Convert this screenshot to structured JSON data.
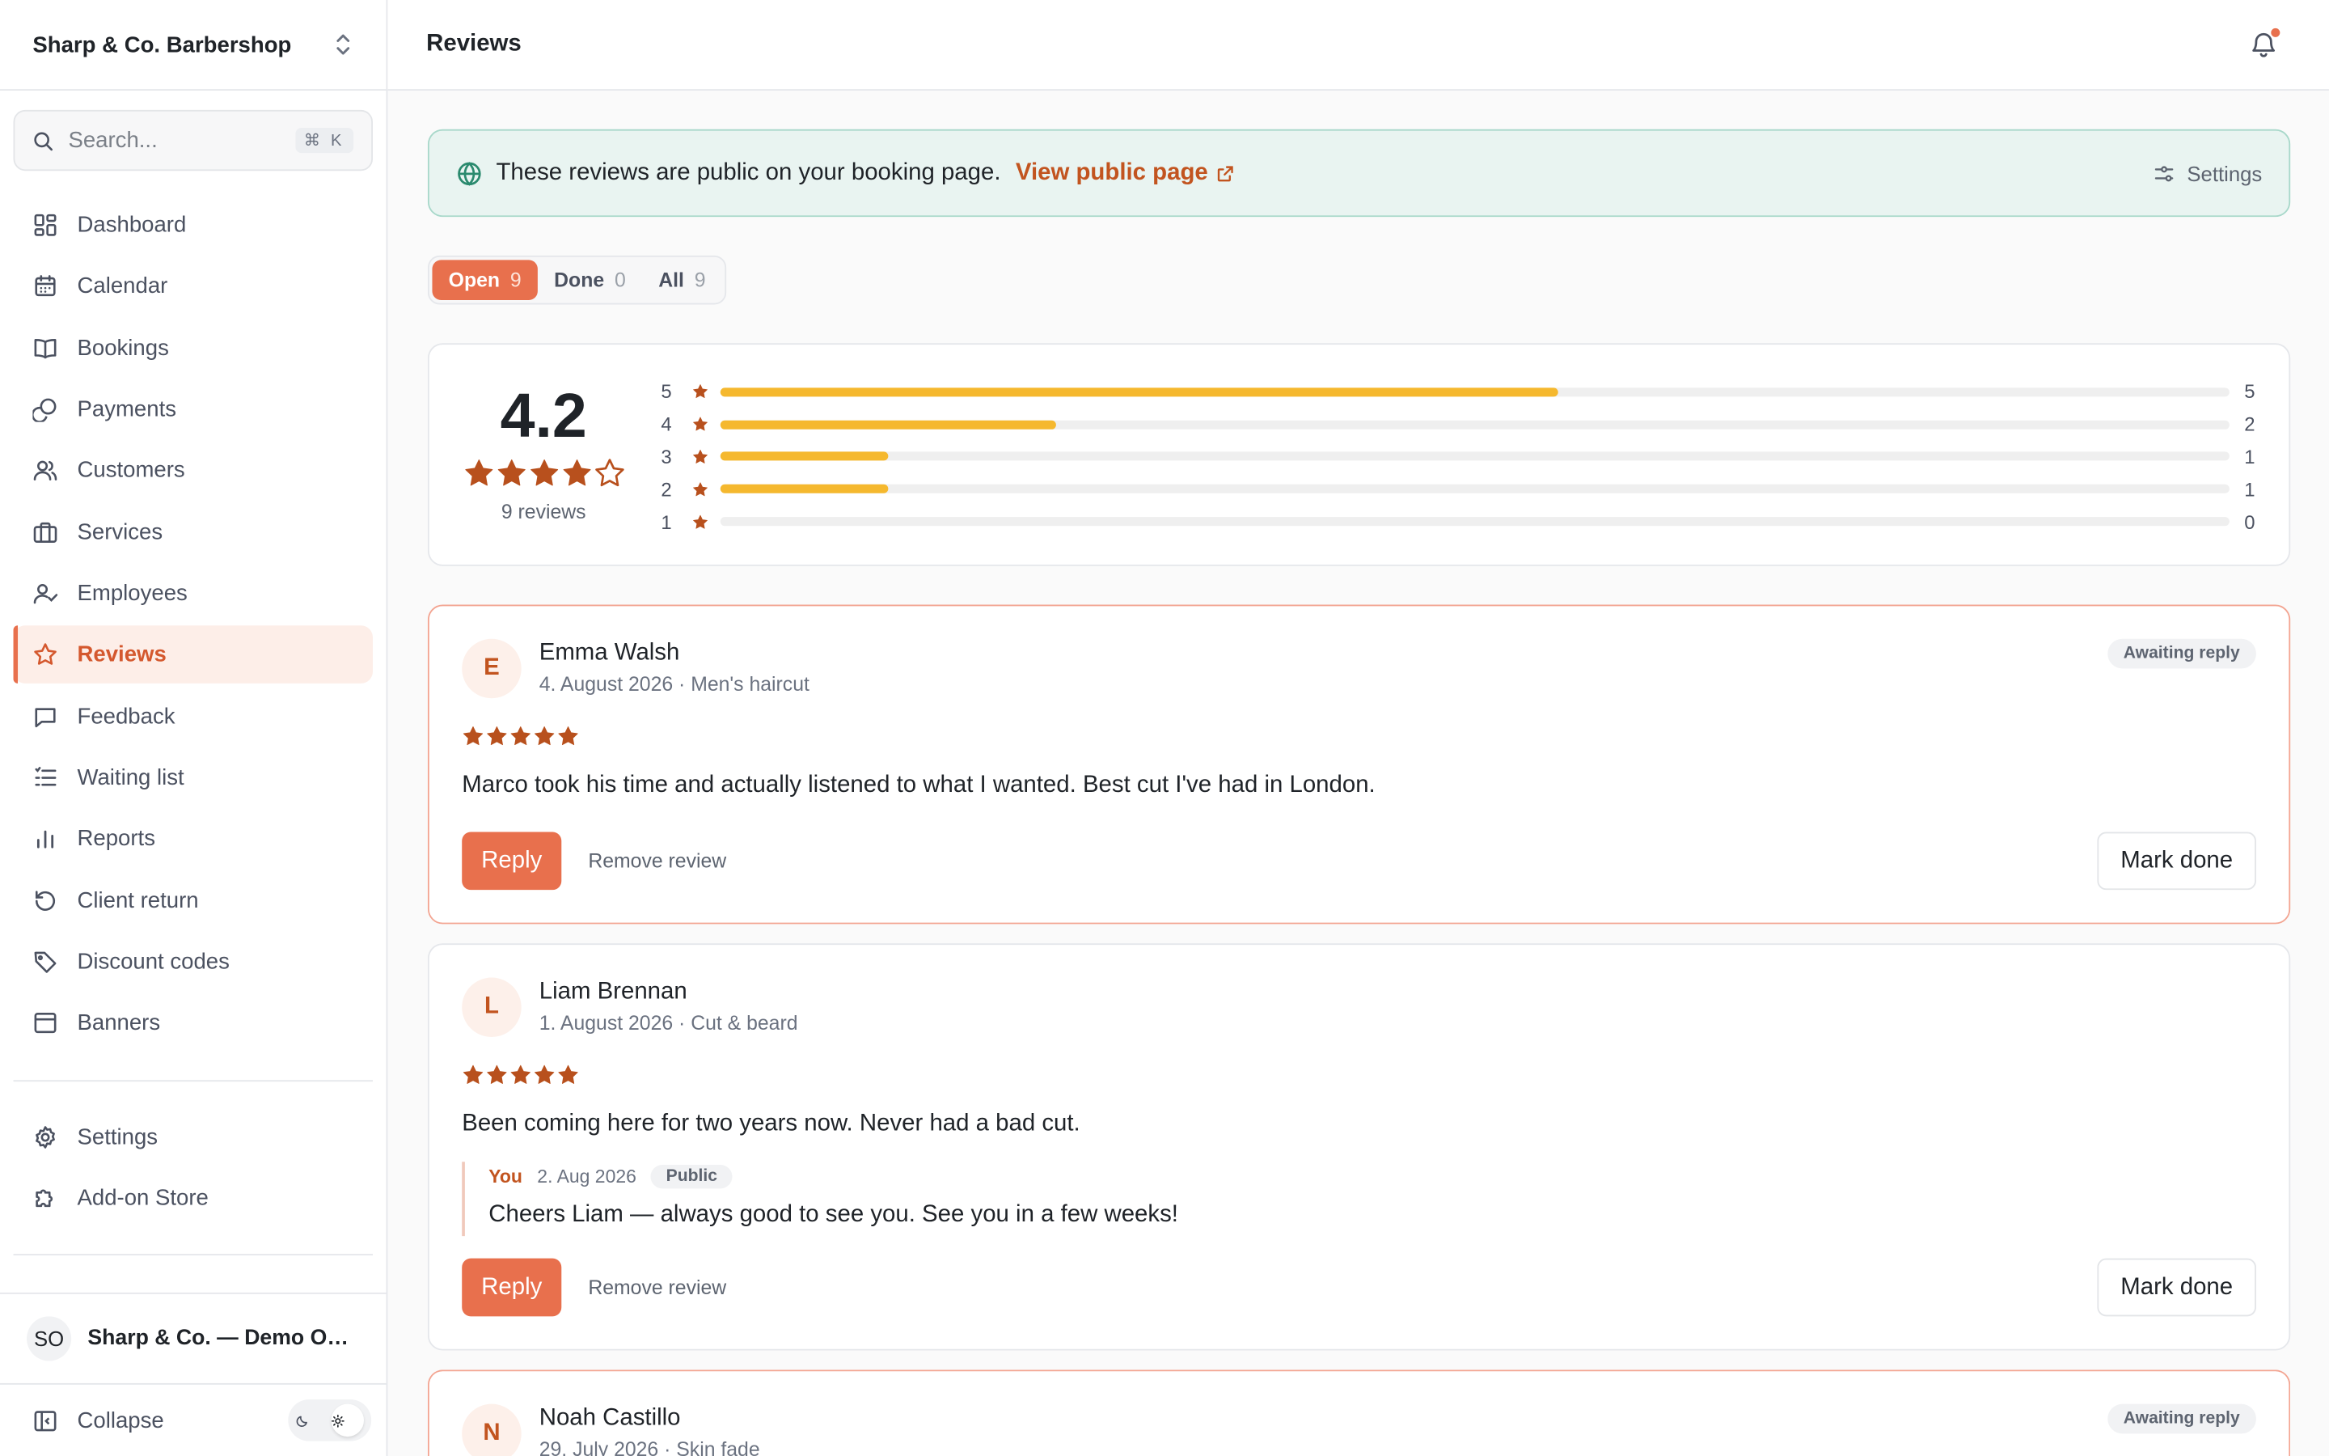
{
  "sidebar": {
    "org_name": "Sharp & Co. Barbershop",
    "search": {
      "placeholder": "Search...",
      "shortcut": "⌘ K"
    },
    "nav": [
      {
        "label": "Dashboard",
        "icon": "dashboard-icon"
      },
      {
        "label": "Calendar",
        "icon": "calendar-icon"
      },
      {
        "label": "Bookings",
        "icon": "book-icon"
      },
      {
        "label": "Payments",
        "icon": "coins-icon"
      },
      {
        "label": "Customers",
        "icon": "users-icon"
      },
      {
        "label": "Services",
        "icon": "briefcase-icon"
      },
      {
        "label": "Employees",
        "icon": "user-check-icon"
      },
      {
        "label": "Reviews",
        "icon": "star-icon",
        "active": true
      },
      {
        "label": "Feedback",
        "icon": "message-icon"
      },
      {
        "label": "Waiting list",
        "icon": "list-icon"
      },
      {
        "label": "Reports",
        "icon": "bar-chart-icon"
      },
      {
        "label": "Client return",
        "icon": "rotate-icon"
      },
      {
        "label": "Discount codes",
        "icon": "tag-icon"
      },
      {
        "label": "Banners",
        "icon": "banner-icon"
      }
    ],
    "nav_secondary": [
      {
        "label": "Settings",
        "icon": "gear-icon"
      },
      {
        "label": "Add-on Store",
        "icon": "puzzle-icon"
      }
    ],
    "user": {
      "initials": "SO",
      "name": "Sharp & Co. — Demo Owner"
    },
    "collapse_label": "Collapse"
  },
  "header": {
    "title": "Reviews"
  },
  "banner": {
    "text": "These reviews are public on your booking page.",
    "link": "View public page",
    "settings": "Settings"
  },
  "tabs": [
    {
      "label": "Open",
      "count": "9",
      "active": true
    },
    {
      "label": "Done",
      "count": "0"
    },
    {
      "label": "All",
      "count": "9"
    }
  ],
  "summary": {
    "average": "4.2",
    "rating_value": 4.2,
    "count_label": "9 reviews",
    "distribution": [
      {
        "stars": "5",
        "count": "5",
        "value": 5
      },
      {
        "stars": "4",
        "count": "2",
        "value": 2
      },
      {
        "stars": "3",
        "count": "1",
        "value": 1
      },
      {
        "stars": "2",
        "count": "1",
        "value": 1
      },
      {
        "stars": "1",
        "count": "0",
        "value": 0
      }
    ],
    "max_count": 9
  },
  "reviews": [
    {
      "initial": "E",
      "name": "Emma Walsh",
      "meta": "4. August 2026 · Men's haircut",
      "rating": 5,
      "text": "Marco took his time and actually listened to what I wanted. Best cut I've had in London.",
      "badge": "Awaiting reply",
      "reply_label": "Reply",
      "remove_label": "Remove review",
      "done_label": "Mark done"
    },
    {
      "initial": "L",
      "name": "Liam Brennan",
      "meta": "1. August 2026 · Cut & beard",
      "rating": 5,
      "text": "Been coming here for two years now. Never had a bad cut.",
      "owner_reply": {
        "author": "You",
        "date": "2. Aug 2026",
        "visibility": "Public",
        "text": "Cheers Liam — always good to see you. See you in a few weeks!"
      },
      "reply_label": "Reply",
      "remove_label": "Remove review",
      "done_label": "Mark done"
    },
    {
      "initial": "N",
      "name": "Noah Castillo",
      "meta": "29. July 2026 · Skin fade",
      "badge": "Awaiting reply"
    }
  ],
  "colors": {
    "accent": "#e8704d",
    "star": "#b8501d",
    "bar": "#f5b82e",
    "banner_bg": "#e9f4f1",
    "banner_border": "#a8d8ca"
  }
}
